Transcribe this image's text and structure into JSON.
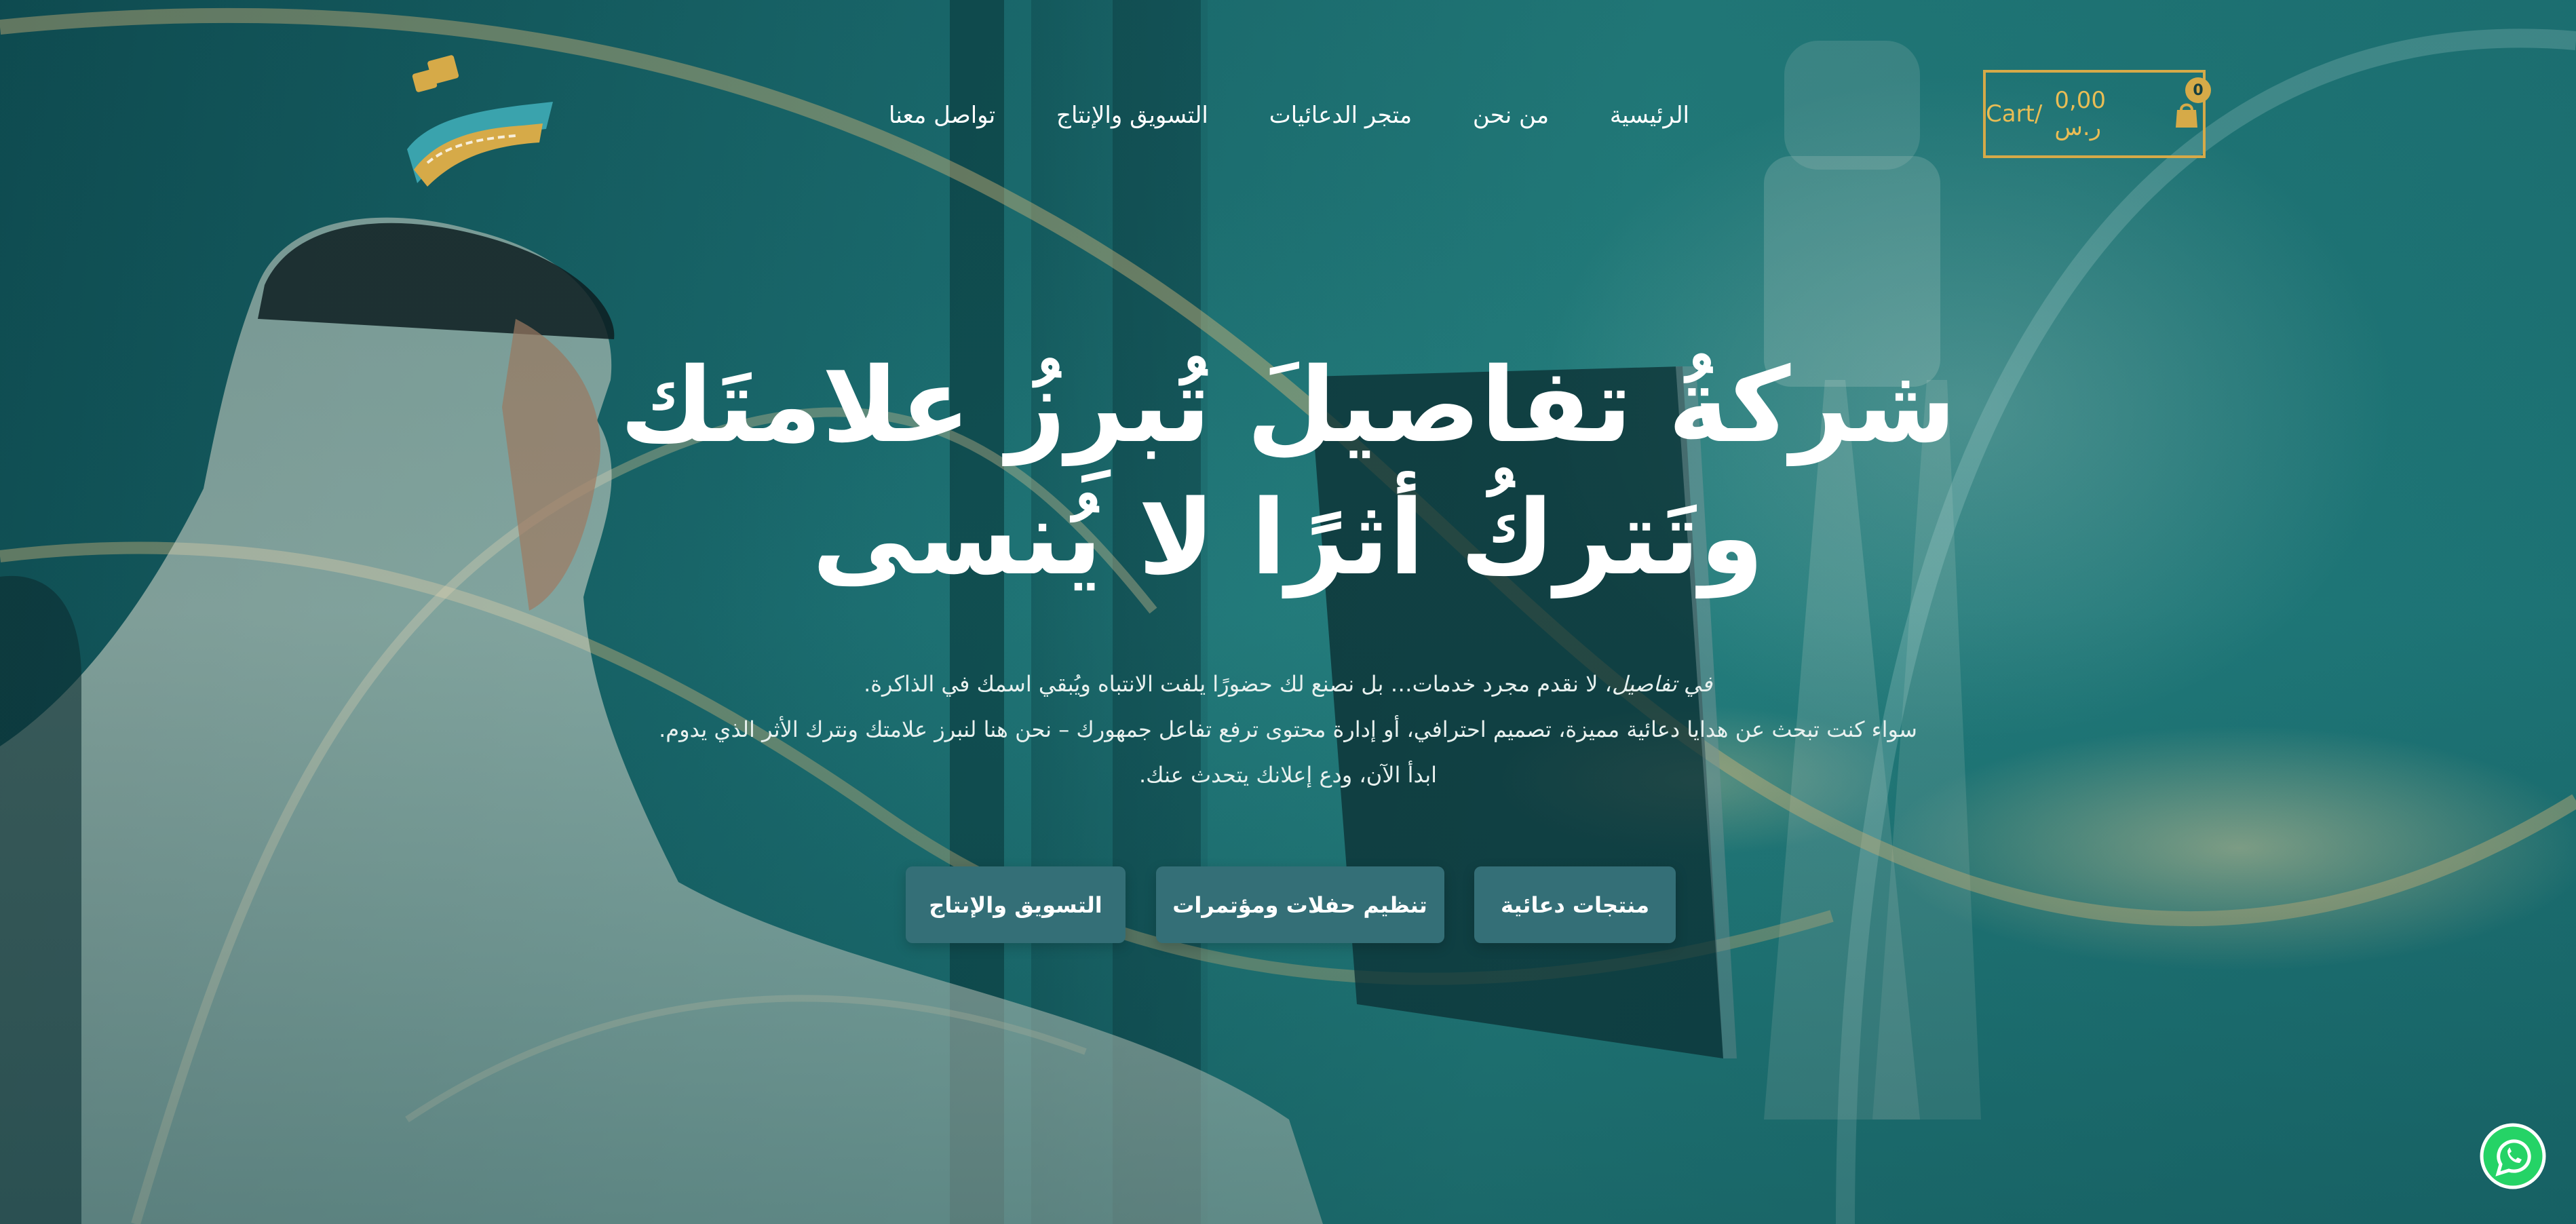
{
  "nav": {
    "items": [
      {
        "label": "الرئيسية"
      },
      {
        "label": "من نحن"
      },
      {
        "label": "متجر الدعائيات"
      },
      {
        "label": "التسويق والإنتاج"
      },
      {
        "label": "تواصل معنا"
      }
    ]
  },
  "cart": {
    "label": "Cart/",
    "amount": "0,00 ر.س",
    "count": "0"
  },
  "hero": {
    "headline_line1": "شركةُ تفاصيلَ تُبرِزُ علامتَك",
    "headline_line2": "وتَتركُ أثرًا لا يُنسى",
    "desc_line1_lead": "في تفاصيل",
    "desc_line1_rest": "، لا نقدم مجرد خدمات… بل نصنع لك حضورًا يلفت الانتباه ويُبقي اسمك في الذاكرة.",
    "desc_line2": "سواء كنت تبحث عن هدايا دعائية مميزة، تصميم احترافي، أو إدارة محتوى ترفع تفاعل جمهورك – نحن هنا لنبرز علامتك ونترك الأثر الذي يدوم.",
    "desc_line3": "ابدأ الآن، ودع إعلانك يتحدث عنك."
  },
  "buttons": {
    "promo_products": "منتجات دعائية",
    "events": "تنظيم حفلات ومؤتمرات",
    "marketing": "التسويق والإنتاج"
  },
  "colors": {
    "accent_gold": "#d6aa48",
    "button_teal": "#346f77",
    "whatsapp_green": "#25d366"
  },
  "icons": {
    "cart": "shopping-bag-icon",
    "whatsapp": "whatsapp-icon",
    "logo": "brand-logo"
  }
}
